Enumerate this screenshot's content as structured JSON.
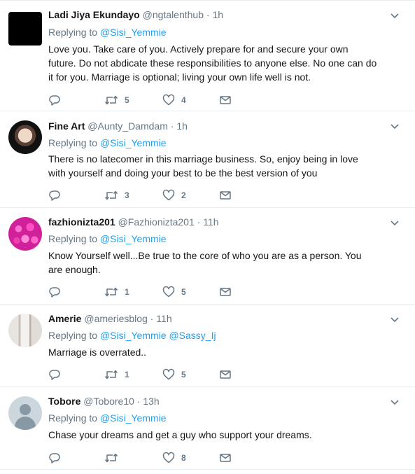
{
  "replying_label": "Replying to",
  "tweets": [
    {
      "name": "Ladi Jiya Ekundayo",
      "handle": "@ngtalenthub",
      "dot": "·",
      "time": "1h",
      "mentions": [
        "@Sisi_Yemmie"
      ],
      "text": "Love you. Take care of you. Actively prepare for and secure your own future. Do not abdicate these responsibilities to anyone else. No one can do it for you. Marriage is optional; living your own life well is not.",
      "retweets": "5",
      "likes": "4",
      "avatar": "black-square"
    },
    {
      "name": "Fine Art",
      "handle": "@Aunty_Damdam",
      "dot": "·",
      "time": "1h",
      "mentions": [
        "@Sisi_Yemmie"
      ],
      "text": "There is no latecomer in this marriage business. So, enjoy being in love with yourself and doing your best to be the best version of you",
      "retweets": "3",
      "likes": "2",
      "avatar": "woman-portrait"
    },
    {
      "name": "fazhionizta201",
      "handle": "@Fazhionizta201",
      "dot": "·",
      "time": "11h",
      "mentions": [
        "@Sisi_Yemmie"
      ],
      "text": "Know Yourself well...Be true to the core of who you are as a person. You are enough.",
      "retweets": "1",
      "likes": "5",
      "avatar": "pink-flowers"
    },
    {
      "name": "Amerie",
      "handle": "@ameriesblog",
      "dot": "·",
      "time": "11h",
      "mentions": [
        "@Sisi_Yemmie",
        "@Sassy_Ij"
      ],
      "text": "Marriage is overrated..",
      "retweets": "1",
      "likes": "5",
      "avatar": "fashion-photo"
    },
    {
      "name": "Tobore",
      "handle": "@Tobore10",
      "dot": "·",
      "time": "13h",
      "mentions": [
        "@Sisi_Yemmie"
      ],
      "text": "Chase your dreams and get a guy who support your dreams.",
      "retweets": "",
      "likes": "8",
      "avatar": "default-person"
    }
  ],
  "icons": {
    "reply": "reply-bubble-icon",
    "retweet": "retweet-arrows-icon",
    "like": "heart-icon",
    "dm": "envelope-icon",
    "more": "chevron-down-icon"
  },
  "colors": {
    "link": "#1da1f2",
    "secondary_text": "#657786",
    "primary_text": "#14171a",
    "divider": "#e6ecf0"
  }
}
